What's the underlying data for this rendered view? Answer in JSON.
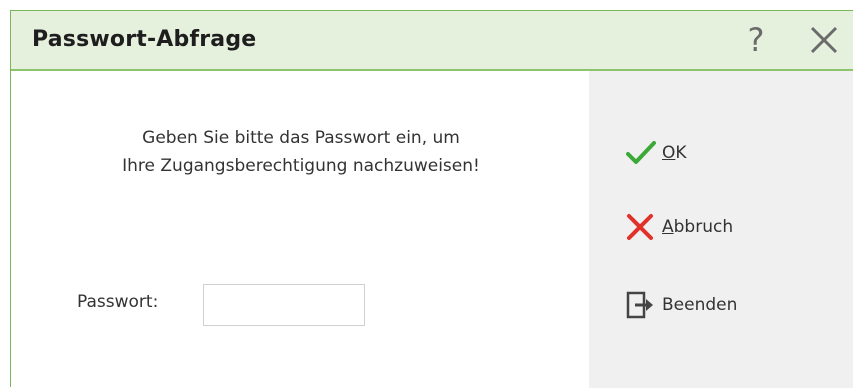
{
  "window": {
    "title": "Passwort-Abfrage",
    "help_label": "?",
    "help_icon": "question-mark-icon",
    "close_icon": "close-icon"
  },
  "main": {
    "message_line1": "Geben Sie bitte das Passwort ein, um",
    "message_line2": "Ihre Zugangsberechtigung nachzuweisen!",
    "password_label": "Passwort:",
    "password_value": ""
  },
  "actions": {
    "ok": {
      "mnemonic": "O",
      "rest": "K",
      "icon": "checkmark-icon",
      "color": "#3aa935"
    },
    "cancel": {
      "mnemonic": "A",
      "rest": "bbruch",
      "icon": "x-cross-icon",
      "color": "#e0312a"
    },
    "exit": {
      "label": "Beenden",
      "icon": "exit-door-icon",
      "color": "#444444"
    }
  },
  "colors": {
    "titlebar_bg": "#e5f0dd",
    "accent_border": "#8cc46b",
    "side_panel_bg": "#f0f0f0"
  }
}
